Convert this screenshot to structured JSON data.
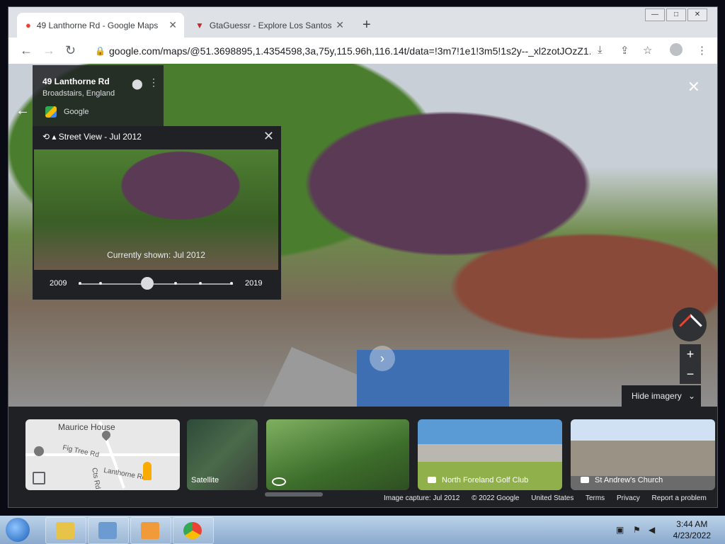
{
  "browser": {
    "tabs": [
      {
        "title": "49 Lanthorne Rd - Google Maps",
        "active": true
      },
      {
        "title": "GtaGuessr - Explore Los Santos w",
        "active": false
      }
    ],
    "url": "google.com/maps/@51.3698895,1.4354598,3a,75y,115.96h,116.14t/data=!3m7!1e1!3m5!1s2y--_xl2zotJOzZ1..."
  },
  "place": {
    "title": "49 Lanthorne Rd",
    "subtitle": "Broadstairs, England",
    "source": "Google"
  },
  "time_machine": {
    "header": "Street View - Jul 2012",
    "currently_shown": "Currently shown: Jul 2012",
    "start_year": "2009",
    "end_year": "2019"
  },
  "controls": {
    "hide_imagery": "Hide imagery"
  },
  "imagery": {
    "map_labels": {
      "maurice": "Maurice House",
      "fig_tree": "Fig Tree Rd",
      "lanthorne": "Lanthorne Rd",
      "cts": "Cts Rd"
    },
    "satellite": "Satellite",
    "golf": "North Foreland Golf Club",
    "church": "St Andrew's Church"
  },
  "footer": {
    "capture": "Image capture: Jul 2012",
    "copyright": "© 2022 Google",
    "country": "United States",
    "terms": "Terms",
    "privacy": "Privacy",
    "report": "Report a problem"
  },
  "taskbar": {
    "time": "3:44 AM",
    "date": "4/23/2022"
  },
  "colors": {
    "maps_dark": "#202124",
    "fence_blue": "#3f6fb3",
    "pegman": "#f9ab00"
  }
}
